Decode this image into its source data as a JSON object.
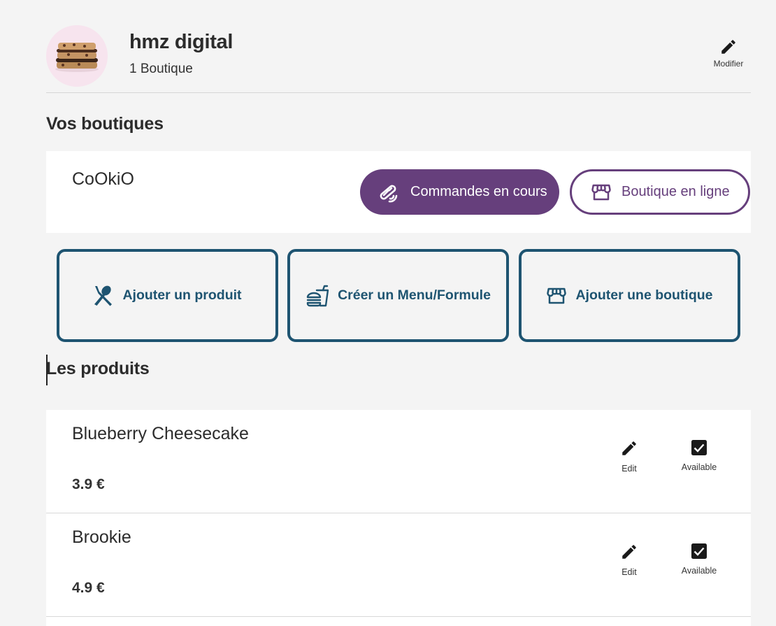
{
  "profile": {
    "name": "hmz digital",
    "subtitle": "1 Boutique",
    "modify_label": "Modifier"
  },
  "shops_section": {
    "title": "Vos boutiques",
    "shop": {
      "name": "CoOkiO",
      "orders_button": "Commandes en cours",
      "online_button": "Boutique en ligne"
    }
  },
  "actions": {
    "add_product": "Ajouter un produit",
    "create_menu": "Créer un Menu/Formule",
    "add_shop": "Ajouter une boutique"
  },
  "products_section": {
    "title": "Les produits",
    "items": [
      {
        "name": "Blueberry Cheesecake",
        "price": "3.9 €",
        "edit_label": "Edit",
        "available_label": "Available",
        "available": true
      },
      {
        "name": "Brookie",
        "price": "4.9 €",
        "edit_label": "Edit",
        "available_label": "Available",
        "available": true
      }
    ]
  },
  "colors": {
    "background": "#f4f4f4",
    "purple_accent": "#663f7c",
    "teal_accent": "#1e5471",
    "text": "#2c2c2c"
  },
  "icons": {
    "modify": "pencil-icon",
    "orders": "tools-icon",
    "online": "storefront-icon",
    "add_product": "utensils-icon",
    "create_menu": "fast-food-icon",
    "add_shop": "storefront-icon",
    "edit": "pencil-icon",
    "available": "checkbox-checked-icon"
  }
}
